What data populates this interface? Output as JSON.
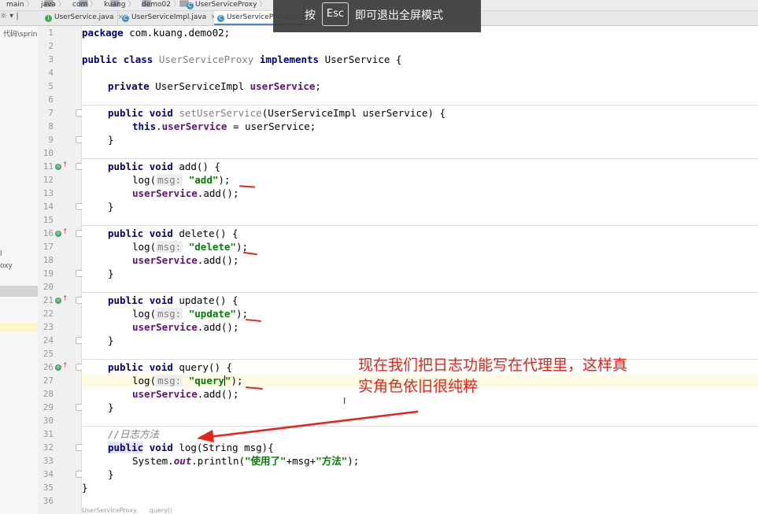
{
  "breadcrumb": {
    "items": [
      "main",
      "java",
      "com",
      "kuang",
      "demo02",
      "UserServiceProxy"
    ]
  },
  "tabs": [
    {
      "label": "UserService.java",
      "icon": "I",
      "icon_color": "#46a55a",
      "close": "×",
      "active": false
    },
    {
      "label": "UserServiceImpl.java",
      "icon": "C",
      "icon_color": "#3592c4",
      "close": "×",
      "active": false
    },
    {
      "label": "UserServiceProxy.java",
      "icon": "C",
      "icon_color": "#3592c4",
      "close": "",
      "active": true
    }
  ],
  "side_panel": {
    "tool_icons": "☼ ▾ | ",
    "path_label": "代码\\sprin",
    "item_1": "l",
    "item_2": "oxy"
  },
  "editor": {
    "lines": [
      {
        "num": "1"
      },
      {
        "num": "2"
      },
      {
        "num": "3"
      },
      {
        "num": "4"
      },
      {
        "num": "5"
      },
      {
        "num": "6"
      },
      {
        "num": "7"
      },
      {
        "num": "8"
      },
      {
        "num": "9"
      },
      {
        "num": "10"
      },
      {
        "num": "11"
      },
      {
        "num": "12"
      },
      {
        "num": "13"
      },
      {
        "num": "14"
      },
      {
        "num": "15"
      },
      {
        "num": "16"
      },
      {
        "num": "17"
      },
      {
        "num": "18"
      },
      {
        "num": "19"
      },
      {
        "num": "20"
      },
      {
        "num": "21"
      },
      {
        "num": "22"
      },
      {
        "num": "23"
      },
      {
        "num": "24"
      },
      {
        "num": "25"
      },
      {
        "num": "26"
      },
      {
        "num": "27"
      },
      {
        "num": "28"
      },
      {
        "num": "29"
      },
      {
        "num": "30"
      },
      {
        "num": "31"
      },
      {
        "num": "32"
      },
      {
        "num": "33"
      },
      {
        "num": "34"
      },
      {
        "num": "35"
      },
      {
        "num": "36"
      }
    ],
    "code": {
      "l1_kw": "package",
      "l1_rest": " com.kuang.demo02;",
      "l3_kw1": "public",
      "l3_kw2": "class",
      "l3_name": "UserServiceProxy",
      "l3_kw3": "implements",
      "l3_rest": " UserService {",
      "l5_kw": "private",
      "l5_type": " UserServiceImpl ",
      "l5_field": "userService",
      "l5_end": ";",
      "l7_kw1": "public",
      "l7_kw2": "void",
      "l7_method": "setUserService",
      "l7_rest": "(UserServiceImpl userService) {",
      "l8_kw": "this",
      "l8_dot": ".",
      "l8_field": "userService",
      "l8_rest": " = userService;",
      "l9": "}",
      "l11_kw1": "public",
      "l11_kw2": "void",
      "l11_rest": " add() {",
      "l12_call": "log(",
      "l12_hint": "msg:",
      "l12_str": "\"add\"",
      "l12_end": ");",
      "l13_field": "userService",
      "l13_rest": ".add();",
      "l14": "}",
      "l16_kw1": "public",
      "l16_kw2": "void",
      "l16_rest": " delete() {",
      "l17_call": "log(",
      "l17_hint": "msg:",
      "l17_str": "\"delete\"",
      "l17_end": ");",
      "l18_field": "userService",
      "l18_rest": ".add();",
      "l19": "}",
      "l21_kw1": "public",
      "l21_kw2": "void",
      "l21_rest": " update() {",
      "l22_call": "log(",
      "l22_hint": "msg:",
      "l22_str": "\"update\"",
      "l22_end": ");",
      "l23_field": "userService",
      "l23_rest": ".add();",
      "l24": "}",
      "l26_kw1": "public",
      "l26_kw2": "void",
      "l26_rest": " query() {",
      "l27_call": "log(",
      "l27_hint": "msg:",
      "l27_str_a": "\"query",
      "l27_str_b": "\"",
      "l27_end": ");",
      "l28_field": "userService",
      "l28_rest": ".add();",
      "l29": "}",
      "l31_comment": "//日志方法",
      "l32_kw1": "public",
      "l32_kw2": "void",
      "l32_rest": " log(String msg){",
      "l33_a": "System.",
      "l33_out": "out",
      "l33_b": ".println(",
      "l33_s1": "\"使用了\"",
      "l33_c": "+msg+",
      "l33_s2": "\"方法\"",
      "l33_d": ");",
      "l34": "}",
      "l35": "}"
    }
  },
  "annotation": {
    "text": "现在我们把日志功能写在代理里，这样真实角色依旧很纯粹",
    "color": "#e8241a"
  },
  "fullscreen_toast": {
    "press": "按",
    "key": "Esc",
    "message": "即可退出全屏模式"
  },
  "status_breadcrumb": {
    "class_name": "UserServiceProxy",
    "method_name": "query()"
  }
}
